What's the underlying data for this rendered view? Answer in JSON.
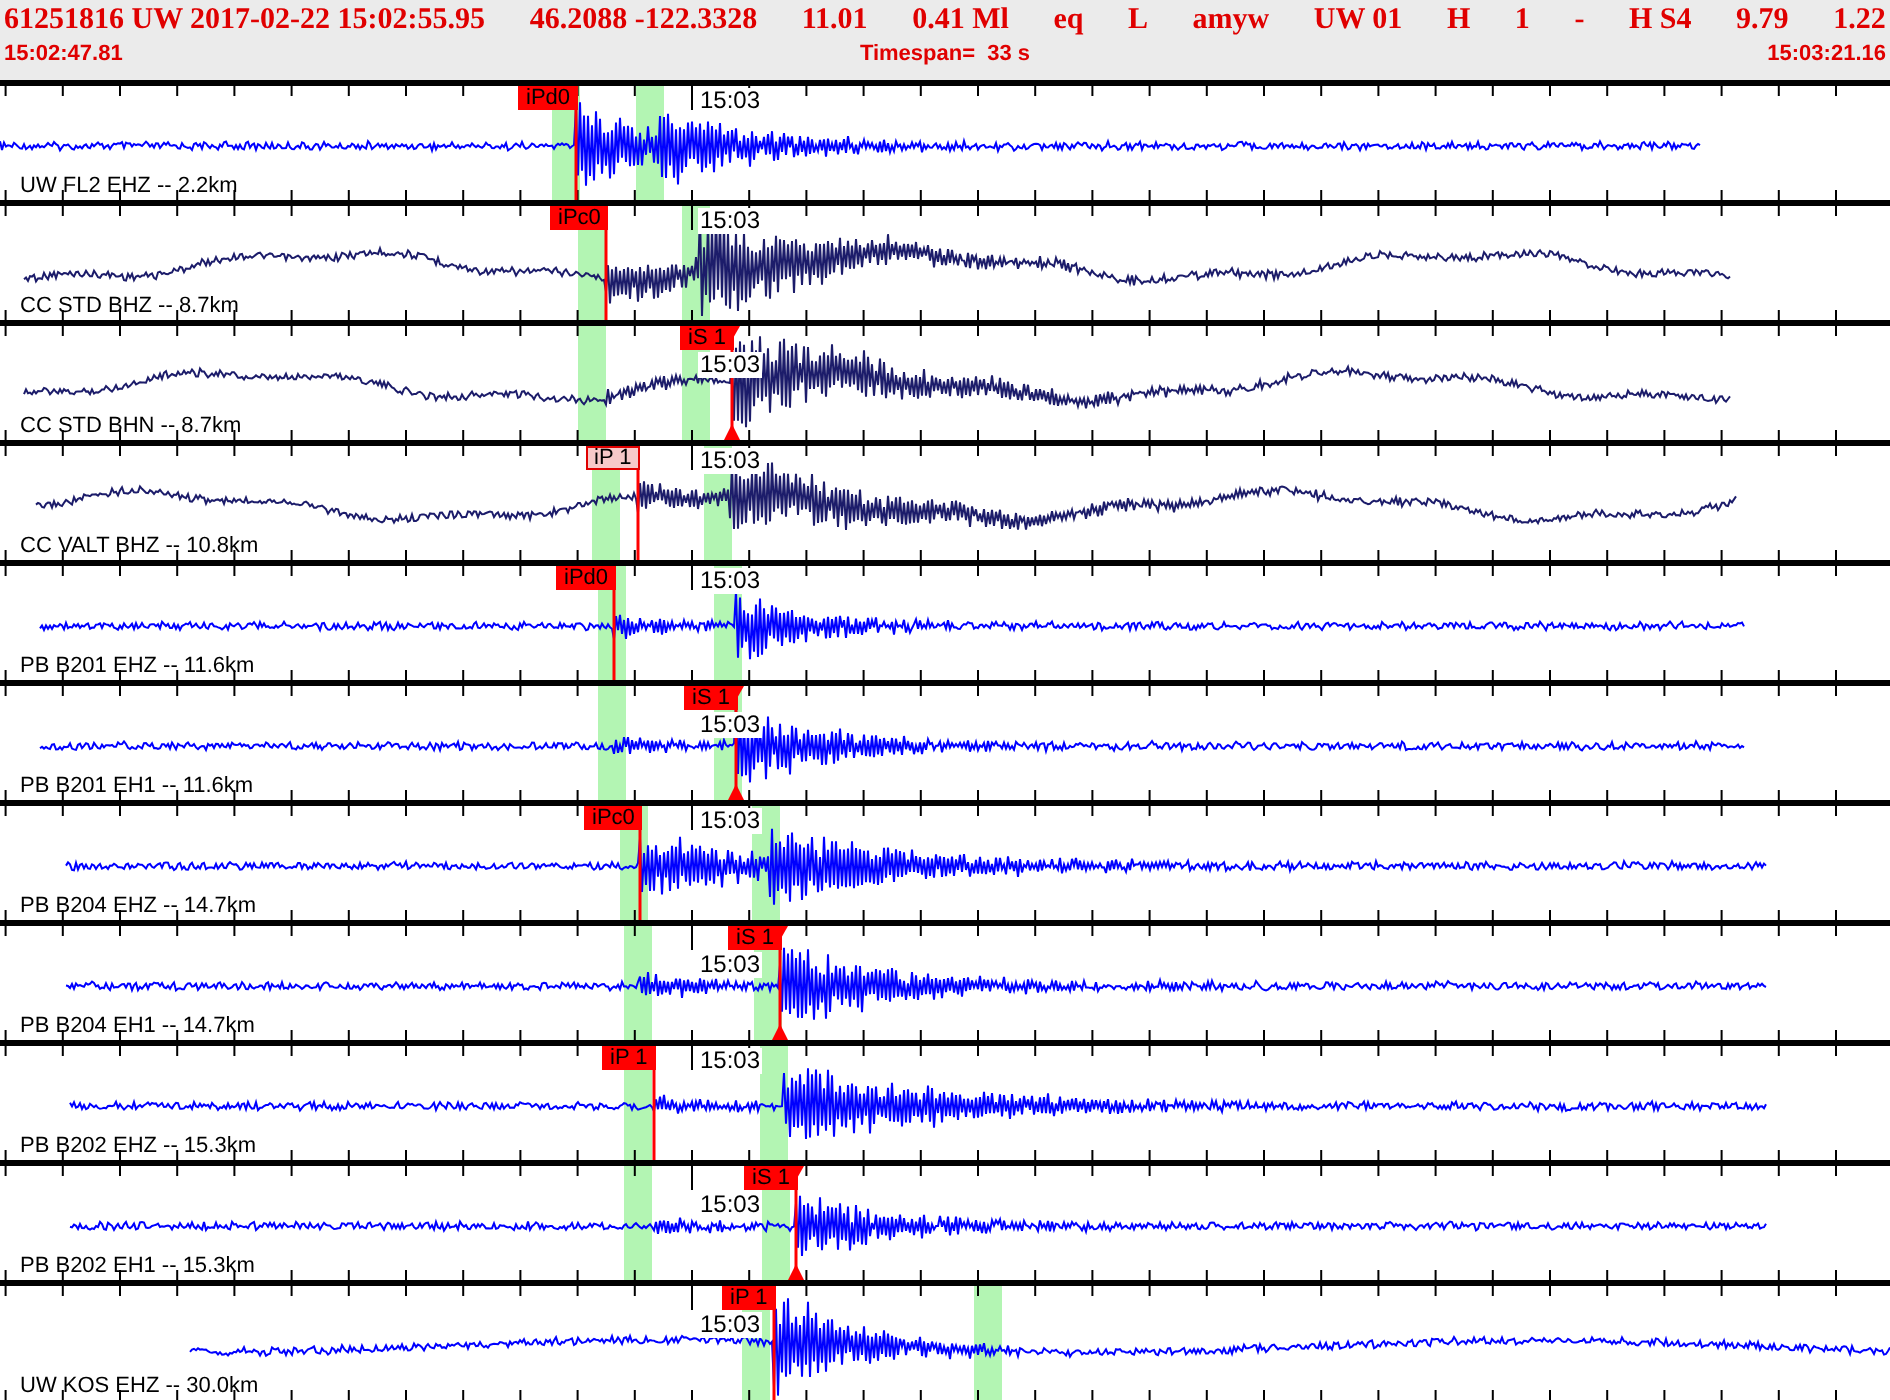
{
  "header": {
    "event_fields": [
      "61251816 UW 2017-02-22 15:02:55.95",
      "46.2088 -122.3328",
      "11.01",
      "0.41 Ml",
      "eq",
      "L",
      "amyw",
      "UW 01",
      "H",
      "1",
      "-",
      "H S4",
      "9.79",
      "1.22"
    ],
    "start_time": "15:02:47.81",
    "timespan": "Timespan=  33 s",
    "end_time": "15:03:21.16"
  },
  "traces": [
    {
      "station": "UW FL2 EHZ -- 2.2km",
      "time_label": "15:03",
      "color": "#0000ff",
      "pick": {
        "label": "iPd0",
        "kind": "p",
        "selected": false
      }
    },
    {
      "station": "CC STD BHZ -- 8.7km",
      "time_label": "15:03",
      "color": "#1c1c6a",
      "pick": {
        "label": "iPc0",
        "kind": "p",
        "selected": false
      }
    },
    {
      "station": "CC STD BHN -- 8.7km",
      "time_label": "15:03",
      "color": "#1c1c6a",
      "pick": {
        "label": "iS 1",
        "kind": "s",
        "selected": false
      }
    },
    {
      "station": "CC VALT BHZ -- 10.8km",
      "time_label": "15:03",
      "color": "#1c1c6a",
      "pick": {
        "label": "iP 1",
        "kind": "p",
        "selected": true
      }
    },
    {
      "station": "PB B201 EHZ -- 11.6km",
      "time_label": "15:03",
      "color": "#0000ff",
      "pick": {
        "label": "iPd0",
        "kind": "p",
        "selected": false
      }
    },
    {
      "station": "PB B201 EH1 -- 11.6km",
      "time_label": "15:03",
      "color": "#0000ff",
      "pick": {
        "label": "iS 1",
        "kind": "s",
        "selected": false
      }
    },
    {
      "station": "PB B204 EHZ -- 14.7km",
      "time_label": "15:03",
      "color": "#0000ff",
      "pick": {
        "label": "iPc0",
        "kind": "p",
        "selected": false
      }
    },
    {
      "station": "PB B204 EH1 -- 14.7km",
      "time_label": "15:03",
      "color": "#0000ff",
      "pick": {
        "label": "iS 1",
        "kind": "s",
        "selected": false
      }
    },
    {
      "station": "PB B202 EHZ -- 15.3km",
      "time_label": "15:03",
      "color": "#0000ff",
      "pick": {
        "label": "iP 1",
        "kind": "p",
        "selected": false
      }
    },
    {
      "station": "PB B202 EH1 -- 15.3km",
      "time_label": "15:03",
      "color": "#0000ff",
      "pick": {
        "label": "iS 1",
        "kind": "s",
        "selected": false
      }
    },
    {
      "station": "UW KOS EHZ -- 30.0km",
      "time_label": "15:03",
      "color": "#0000ff",
      "pick": {
        "label": "iP 1",
        "kind": "p",
        "selected": false
      }
    }
  ]
}
